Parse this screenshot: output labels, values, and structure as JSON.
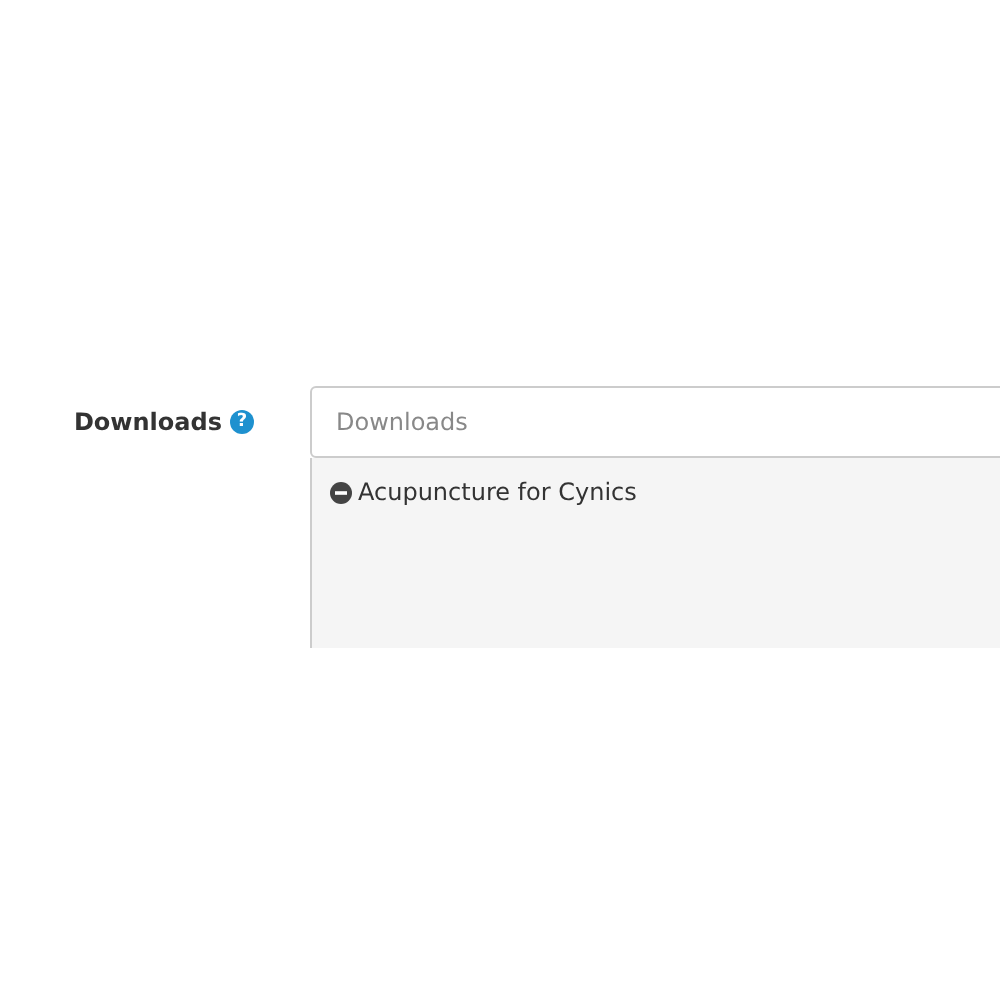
{
  "field": {
    "label": "Downloads",
    "help": "?",
    "placeholder": "Downloads"
  },
  "items": [
    {
      "name": "Acupuncture for Cynics"
    }
  ]
}
